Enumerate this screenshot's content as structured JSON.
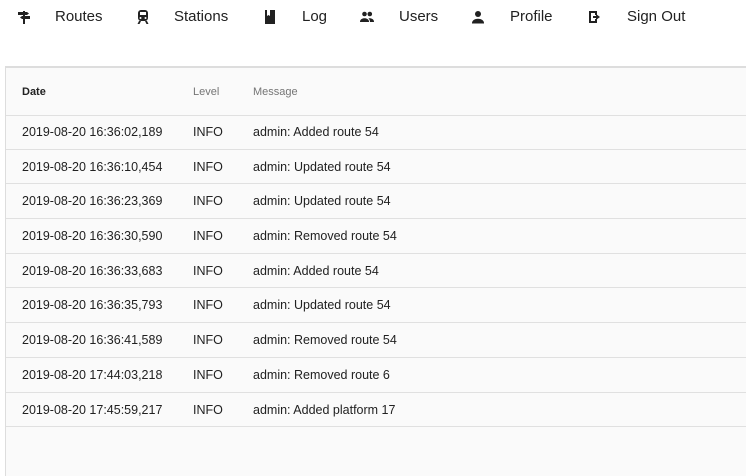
{
  "nav": {
    "items": [
      {
        "label": "Routes",
        "icon": "signpost-icon"
      },
      {
        "label": "Stations",
        "icon": "train-icon"
      },
      {
        "label": "Log",
        "icon": "book-icon"
      },
      {
        "label": "Users",
        "icon": "users-icon"
      },
      {
        "label": "Profile",
        "icon": "person-icon"
      },
      {
        "label": "Sign Out",
        "icon": "exit-icon"
      }
    ]
  },
  "table": {
    "headers": {
      "date": "Date",
      "level": "Level",
      "message": "Message"
    },
    "rows": [
      {
        "date": "2019-08-20 16:36:02,189",
        "level": "INFO",
        "message": "admin: Added route 54"
      },
      {
        "date": "2019-08-20 16:36:10,454",
        "level": "INFO",
        "message": "admin: Updated route 54"
      },
      {
        "date": "2019-08-20 16:36:23,369",
        "level": "INFO",
        "message": "admin: Updated route 54"
      },
      {
        "date": "2019-08-20 16:36:30,590",
        "level": "INFO",
        "message": "admin: Removed route 54"
      },
      {
        "date": "2019-08-20 16:36:33,683",
        "level": "INFO",
        "message": "admin: Added route 54"
      },
      {
        "date": "2019-08-20 16:36:35,793",
        "level": "INFO",
        "message": "admin: Updated route 54"
      },
      {
        "date": "2019-08-20 16:36:41,589",
        "level": "INFO",
        "message": "admin: Removed route 54"
      },
      {
        "date": "2019-08-20 17:44:03,218",
        "level": "INFO",
        "message": "admin: Removed route 6"
      },
      {
        "date": "2019-08-20 17:45:59,217",
        "level": "INFO",
        "message": "admin: Added platform 17"
      }
    ]
  }
}
